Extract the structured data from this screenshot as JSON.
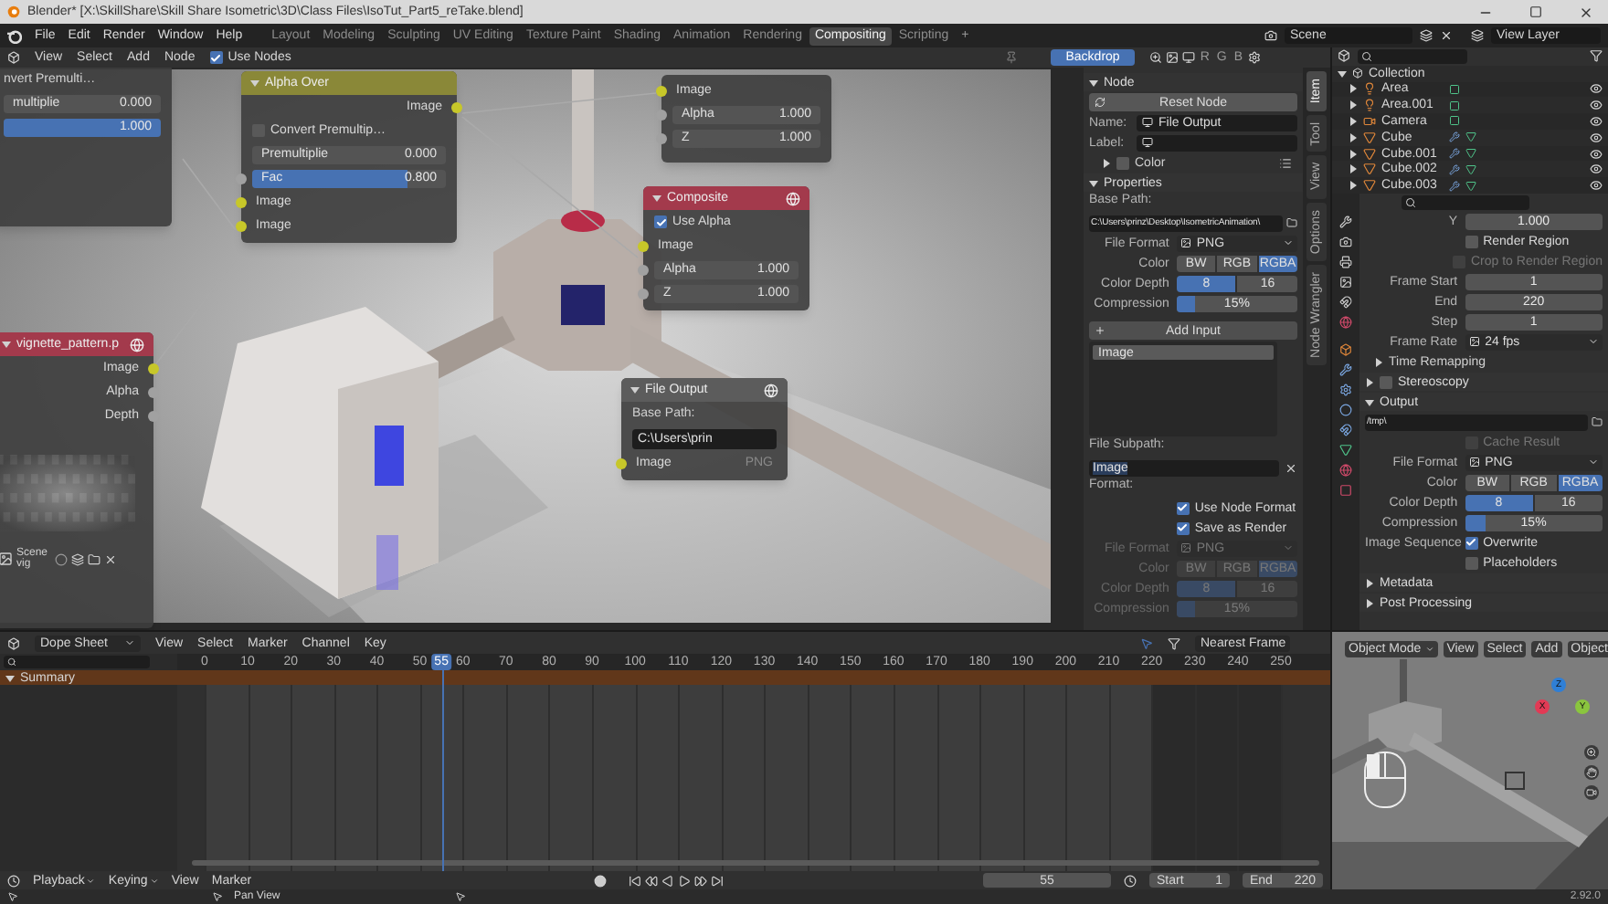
{
  "title_bar": {
    "title": "Blender* [X:\\SkillShare\\Skill Share Isometric\\3D\\Class Files\\IsoTut_Part5_reTake.blend]"
  },
  "top_bar": {
    "menus": [
      "File",
      "Edit",
      "Render",
      "Window",
      "Help"
    ],
    "workspaces": [
      {
        "label": "Layout",
        "selected": false
      },
      {
        "label": "Modeling",
        "selected": false
      },
      {
        "label": "Sculpting",
        "selected": false
      },
      {
        "label": "UV Editing",
        "selected": false
      },
      {
        "label": "Texture Paint",
        "selected": false
      },
      {
        "label": "Shading",
        "selected": false
      },
      {
        "label": "Animation",
        "selected": false
      },
      {
        "label": "Rendering",
        "selected": false
      },
      {
        "label": "Compositing",
        "selected": true
      },
      {
        "label": "Scripting",
        "selected": false
      }
    ],
    "add_workspace": "+",
    "scene": "Scene",
    "view_layer": "View Layer"
  },
  "node_editor": {
    "menus": [
      "View",
      "Select",
      "Add",
      "Node"
    ],
    "use_nodes": {
      "label": "Use Nodes",
      "checked": true
    },
    "backdrop": {
      "label": "Backdrop",
      "selected": true
    },
    "channels": [
      "R",
      "G",
      "B"
    ],
    "nodes": [
      {
        "rows": [
          {
            "kind": "text",
            "label": "nvert Premulti…"
          },
          {
            "kind": "value",
            "label": "multiplie",
            "value": "0.000"
          },
          {
            "kind": "slider",
            "value": "1.000",
            "level": 1
          }
        ]
      },
      {
        "title": "Alpha Over",
        "color": "#8a8838",
        "expanded": true,
        "rows": [
          {
            "kind": "output",
            "label": "Image",
            "color": "#c7c729"
          },
          {
            "kind": "checkbox",
            "label": "Convert Premultip…",
            "checked": false
          },
          {
            "kind": "value",
            "label": "Premultiplie",
            "value": "0.000"
          },
          {
            "kind": "slider",
            "label": "Fac",
            "value": "0.800",
            "level": 0.8,
            "color": "#a1a1a1"
          },
          {
            "kind": "input",
            "label": "Image",
            "color": "#c7c729"
          },
          {
            "kind": "input",
            "label": "Image",
            "color": "#c7c729"
          }
        ]
      },
      {
        "rows": [
          {
            "kind": "input",
            "label": "Image",
            "color": "#c7c729"
          },
          {
            "kind": "value",
            "label": "Alpha",
            "value": "1.000",
            "color": "#a1a1a1"
          },
          {
            "kind": "value",
            "label": "Z",
            "value": "1.000",
            "color": "#a1a1a1"
          }
        ]
      },
      {
        "title": "Composite",
        "color": "#a33a4c",
        "expanded": true,
        "icon": true,
        "rows": [
          {
            "kind": "checkbox",
            "label": "Use Alpha",
            "checked": true
          },
          {
            "kind": "input",
            "label": "Image",
            "color": "#c7c729"
          },
          {
            "kind": "value",
            "label": "Alpha",
            "value": "1.000",
            "color": "#a1a1a1"
          },
          {
            "kind": "value",
            "label": "Z",
            "value": "1.000",
            "color": "#a1a1a1"
          }
        ]
      },
      {
        "title": "vignette_pattern.p",
        "color": "#a33a4c",
        "expanded": true,
        "icon": true,
        "rows": [
          {
            "kind": "output",
            "label": "Image",
            "color": "#c7c729"
          },
          {
            "kind": "output",
            "label": "Alpha",
            "color": "#a1a1a1"
          },
          {
            "kind": "output",
            "label": "Depth",
            "color": "#a1a1a1"
          },
          {
            "kind": "picture"
          },
          {
            "kind": "image_selector",
            "labels": [
              "Scene",
              "vig"
            ]
          }
        ]
      },
      {
        "title": "File Output",
        "color": "#5c5c5c",
        "expanded": true,
        "icon": true,
        "rows": [
          {
            "kind": "text",
            "label": "Base Path:"
          },
          {
            "kind": "path",
            "value": "C:\\Users\\prin"
          },
          {
            "kind": "input",
            "label": "Image",
            "note": "PNG",
            "color": "#c7c729"
          }
        ]
      }
    ]
  },
  "sidebar": {
    "rows": [
      {
        "kind": "panel",
        "label": "Node",
        "expanded": true
      },
      {
        "kind": "button",
        "label": "Reset Node"
      },
      {
        "kind": "field",
        "label": "Name:",
        "value": "File Output"
      },
      {
        "kind": "field",
        "label": "Label:"
      },
      {
        "kind": "color_toggle",
        "label": "Color",
        "checked": false,
        "expanded": false
      },
      {
        "kind": "panel",
        "label": "Properties",
        "expanded": true
      },
      {
        "kind": "text",
        "label": "Base Path:"
      },
      {
        "kind": "path",
        "value": "C:\\Users\\prinz\\Desktop\\IsometricAnimation\\"
      },
      {
        "kind": "dropdown",
        "label": "File Format",
        "value": "PNG"
      },
      {
        "kind": "segmented",
        "label": "Color",
        "options": [
          {
            "label": "BW",
            "selected": false
          },
          {
            "label": "RGB",
            "selected": false
          },
          {
            "label": "RGBA",
            "selected": true
          }
        ]
      },
      {
        "kind": "segmented",
        "label": "Color Depth",
        "options": [
          {
            "label": "8",
            "selected": true
          },
          {
            "label": "16",
            "selected": false
          }
        ]
      },
      {
        "kind": "slider",
        "label": "Compression",
        "value": "15%",
        "level": 0.15
      },
      {
        "kind": "add_button",
        "label": "Add Input"
      },
      {
        "kind": "list",
        "items": [
          {
            "label": "Image",
            "selected": true
          }
        ]
      },
      {
        "kind": "text",
        "label": "File Subpath:"
      },
      {
        "kind": "subpath",
        "value": "Image"
      },
      {
        "kind": "text",
        "label": "Format:"
      },
      {
        "kind": "checkbox",
        "label": "Use Node Format",
        "checked": true,
        "disabled": false
      },
      {
        "kind": "checkbox",
        "label": "Save as Render",
        "checked": true,
        "disabled": false
      },
      {
        "kind": "dropdown",
        "label": "File Format",
        "value": "PNG",
        "disabled": true
      },
      {
        "kind": "segmented",
        "label": "Color",
        "disabled": true,
        "options": [
          {
            "label": "BW",
            "selected": false
          },
          {
            "label": "RGB",
            "selected": false
          },
          {
            "label": "RGBA",
            "selected": true
          }
        ]
      },
      {
        "kind": "segmented",
        "label": "Color Depth",
        "disabled": true,
        "options": [
          {
            "label": "8",
            "selected": true
          },
          {
            "label": "16",
            "selected": false
          }
        ]
      },
      {
        "kind": "slider",
        "label": "Compression",
        "value": "15%",
        "level": 0.15,
        "disabled": true
      }
    ],
    "tabs": [
      {
        "label": "Item",
        "selected": true
      },
      {
        "label": "Tool",
        "selected": false
      },
      {
        "label": "View",
        "selected": false
      },
      {
        "label": "Options",
        "selected": false
      },
      {
        "label": "Node Wrangler",
        "selected": false
      }
    ]
  },
  "outliner": {
    "label": "Collection",
    "expanded": true,
    "children": [
      {
        "label": "Area",
        "kind": "light",
        "expanded": false
      },
      {
        "label": "Area.001",
        "kind": "light",
        "expanded": false
      },
      {
        "label": "Camera",
        "kind": "camera",
        "expanded": false
      },
      {
        "label": "Cube",
        "kind": "mesh",
        "expanded": false
      },
      {
        "label": "Cube.001",
        "kind": "mesh",
        "expanded": false
      },
      {
        "label": "Cube.002",
        "kind": "mesh",
        "expanded": false
      },
      {
        "label": "Cube.003",
        "kind": "mesh",
        "expanded": false
      }
    ]
  },
  "properties": {
    "rows": [
      {
        "kind": "value",
        "label": "Y",
        "value": "1.000"
      },
      {
        "kind": "checkbox",
        "label": "Render Region",
        "checked": false,
        "disabled": false
      },
      {
        "kind": "checkbox",
        "label": "Crop to Render Region",
        "checked": false,
        "disabled": true
      },
      {
        "kind": "value",
        "label": "Frame Start",
        "value": "1"
      },
      {
        "kind": "value",
        "label": "End",
        "value": "220"
      },
      {
        "kind": "value",
        "label": "Step",
        "value": "1"
      },
      {
        "kind": "dropdown",
        "label": "Frame Rate",
        "value": "24 fps"
      },
      {
        "kind": "subpanel",
        "label": "Time Remapping",
        "expanded": false
      },
      {
        "kind": "panel",
        "label": "Stereoscopy",
        "expanded": false,
        "checked": false
      },
      {
        "kind": "panel",
        "label": "Output",
        "expanded": true
      },
      {
        "kind": "path",
        "value": "/tmp\\"
      },
      {
        "kind": "checkbox",
        "label": "Cache Result",
        "checked": false,
        "disabled": true
      },
      {
        "kind": "dropdown",
        "label": "File Format",
        "value": "PNG"
      },
      {
        "kind": "segmented",
        "label": "Color",
        "options": [
          {
            "label": "BW",
            "selected": false
          },
          {
            "label": "RGB",
            "selected": false
          },
          {
            "label": "RGBA",
            "selected": true
          }
        ]
      },
      {
        "kind": "segmented",
        "label": "Color Depth",
        "options": [
          {
            "label": "8",
            "selected": true
          },
          {
            "label": "16",
            "selected": false
          }
        ]
      },
      {
        "kind": "slider",
        "label": "Compression",
        "value": "15%",
        "level": 0.15
      },
      {
        "kind": "checkbox",
        "prefix": "Image Sequence",
        "label": "Overwrite",
        "checked": true,
        "disabled": false
      },
      {
        "kind": "checkbox",
        "label": "Placeholders",
        "checked": false,
        "disabled": false
      },
      {
        "kind": "panel",
        "label": "Metadata",
        "expanded": false
      },
      {
        "kind": "panel",
        "label": "Post Processing",
        "expanded": false
      }
    ]
  },
  "dope_sheet": {
    "editor": "Dope Sheet",
    "menus": [
      "View",
      "Select",
      "Marker",
      "Channel",
      "Key"
    ],
    "snap": "Nearest Frame",
    "ruler": [
      "0",
      "10",
      "20",
      "30",
      "40",
      "50",
      "60",
      "70",
      "80",
      "90",
      "100",
      "110",
      "120",
      "130",
      "140",
      "150",
      "160",
      "170",
      "180",
      "190",
      "200",
      "210",
      "220",
      "230",
      "240",
      "250"
    ],
    "playhead": {
      "label": "55",
      "level": 0.22
    },
    "frame_range": {
      "level": 0.88
    },
    "channels": [
      {
        "label": "Summary",
        "expanded": true
      }
    ]
  },
  "timeline": {
    "menus": [
      {
        "label": "Playback",
        "kind": "dropdown"
      },
      {
        "label": "Keying",
        "kind": "dropdown"
      },
      {
        "label": "View",
        "kind": "menu"
      },
      {
        "label": "Marker",
        "kind": "menu"
      }
    ],
    "current_frame": "55",
    "start": {
      "label": "Start",
      "value": "1"
    },
    "end": {
      "label": "End",
      "value": "220"
    }
  },
  "viewport": {
    "mode": "Object Mode",
    "menus": [
      "View",
      "Select",
      "Add",
      "Object"
    ],
    "gizmo": [
      {
        "label": "Z",
        "color": "#2f7fd6"
      },
      {
        "label": "Y",
        "color": "#8ac53e"
      },
      {
        "label": "X",
        "color": "#e23a55"
      }
    ]
  },
  "status_bar": {
    "hint": "Pan View",
    "version": "2.92.0"
  }
}
